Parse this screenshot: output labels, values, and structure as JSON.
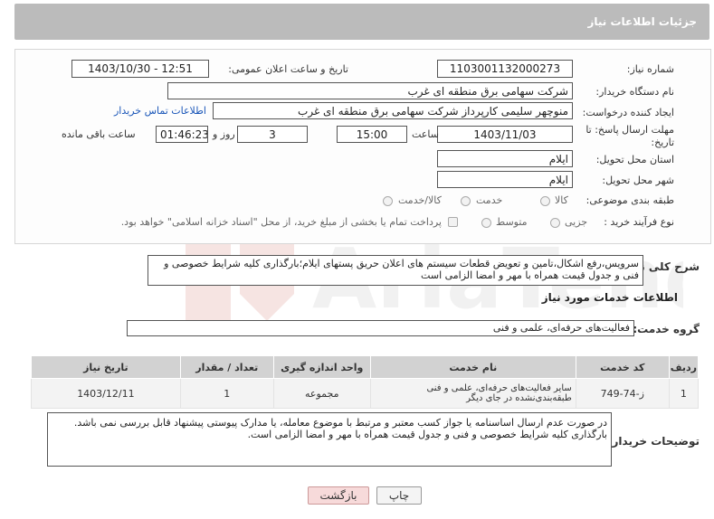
{
  "header": {
    "title": "جزئیات اطلاعات نیاز"
  },
  "form": {
    "need_number": {
      "label": "شماره نیاز:",
      "value": "1103001132000273"
    },
    "announce_datetime": {
      "label": "تاریخ و ساعت اعلان عمومی:",
      "value": "1403/10/30 - 12:51"
    },
    "buyer_org": {
      "label": "نام دستگاه خریدار:",
      "value": "شرکت سهامی برق منطقه ای غرب"
    },
    "requester": {
      "label": "ایجاد کننده درخواست:",
      "value": "منوچهر  سلیمی کارپرداز شرکت سهامی برق منطقه ای غرب",
      "contact_link": "اطلاعات تماس خریدار"
    },
    "deadline": {
      "label_line1": "مهلت ارسال پاسخ: تا",
      "label_line2": "تاریخ:",
      "date": "1403/11/03",
      "time_label": "ساعت",
      "time": "15:00",
      "days": "3",
      "days_label": "روز و",
      "remaining": "01:46:23",
      "remaining_label": "ساعت باقی مانده"
    },
    "delivery_province": {
      "label": "استان محل تحویل:",
      "value": "ایلام"
    },
    "delivery_city": {
      "label": "شهر محل تحویل:",
      "value": "ایلام"
    },
    "category": {
      "label": "طبقه بندی موضوعی:",
      "options": [
        "کالا",
        "خدمت",
        "کالا/خدمت"
      ]
    },
    "process_type": {
      "label": "نوع فرآیند خرید :",
      "options": [
        "جزیی",
        "متوسط"
      ],
      "note": "پرداخت تمام یا بخشی از مبلغ خرید، از محل \"اسناد خزانه اسلامی\" خواهد بود."
    }
  },
  "description": {
    "label": "شرح کلی نیاز:",
    "text": "سرویس،رفع اشکال،تامین و تعویض قطعات سیستم های اعلان حریق پستهای ایلام؛بارگذاری کلیه شرایط خصوصی و فنی و جدول قیمت همراه با مهر و امضا الزامی است"
  },
  "services": {
    "section_title": "اطلاعات خدمات مورد نیاز",
    "group_label": "گروه خدمت:",
    "group_value": "فعالیت‌های حرفه‌ای، علمی و فنی",
    "table": {
      "headers": [
        "ردیف",
        "کد خدمت",
        "نام خدمت",
        "واحد اندازه گیری",
        "تعداد / مقدار",
        "تاریخ نیاز"
      ],
      "rows": [
        [
          "1",
          "ز-74-749",
          "سایر فعالیت‌های حرفه‌ای، علمی و فنی طبقه‌بندی‌نشده در جای دیگر",
          "مجموعه",
          "1",
          "1403/12/11"
        ]
      ]
    }
  },
  "buyer_notes": {
    "label": "توضیحات خریدار:",
    "line1": "در صورت عدم ارسال اساسنامه یا جواز کسب معتبر و مرتبط با موضوع معامله،  یا مدارک پیوستی پیشنهاد قابل بررسی نمی باشد.",
    "line2": "بارگذاری کلیه شرایط خصوصی و فنی و جدول قیمت همراه با مهر و امضا الزامی است."
  },
  "buttons": {
    "print": "چاپ",
    "back": "بازگشت"
  },
  "colors": {
    "header_bg": "#bbbbbb",
    "link": "#1a56b8",
    "back_button_bg": "#f7dada"
  }
}
